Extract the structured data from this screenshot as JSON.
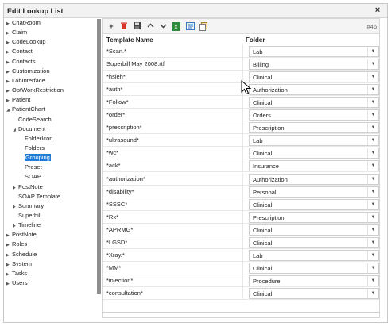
{
  "window": {
    "title": "Edit Lookup List",
    "close_glyph": "×"
  },
  "tree": {
    "items": [
      {
        "label": "ChatRoom",
        "level": 0,
        "arrow": true
      },
      {
        "label": "Claim",
        "level": 0,
        "arrow": true
      },
      {
        "label": "CodeLookup",
        "level": 0,
        "arrow": true
      },
      {
        "label": "Contact",
        "level": 0,
        "arrow": true
      },
      {
        "label": "Contacts",
        "level": 0,
        "arrow": true
      },
      {
        "label": "Customization",
        "level": 0,
        "arrow": true
      },
      {
        "label": "LabInterface",
        "level": 0,
        "arrow": true
      },
      {
        "label": "OptWorkRestriction",
        "level": 0,
        "arrow": true
      },
      {
        "label": "Patient",
        "level": 0,
        "arrow": true
      },
      {
        "label": "PatientChart",
        "level": 0,
        "arrow": true,
        "open": true
      },
      {
        "label": "CodeSearch",
        "level": 1,
        "arrow": false
      },
      {
        "label": "Document",
        "level": 1,
        "arrow": true,
        "open": true
      },
      {
        "label": "FolderIcon",
        "level": 2,
        "arrow": false
      },
      {
        "label": "Folders",
        "level": 2,
        "arrow": false
      },
      {
        "label": "Grouping",
        "level": 2,
        "arrow": false,
        "selected": true
      },
      {
        "label": "Preset",
        "level": 2,
        "arrow": false
      },
      {
        "label": "SOAP",
        "level": 2,
        "arrow": false
      },
      {
        "label": "PostNote",
        "level": 1,
        "arrow": true
      },
      {
        "label": "SOAP Template",
        "level": 1,
        "arrow": false
      },
      {
        "label": "Summary",
        "level": 1,
        "arrow": true
      },
      {
        "label": "Superbill",
        "level": 1,
        "arrow": false
      },
      {
        "label": "Timeline",
        "level": 1,
        "arrow": true
      },
      {
        "label": "PostNote",
        "level": 0,
        "arrow": true
      },
      {
        "label": "Roles",
        "level": 0,
        "arrow": true
      },
      {
        "label": "Schedule",
        "level": 0,
        "arrow": true
      },
      {
        "label": "System",
        "level": 0,
        "arrow": true
      },
      {
        "label": "Tasks",
        "level": 0,
        "arrow": true
      },
      {
        "label": "Users",
        "level": 0,
        "arrow": true
      }
    ]
  },
  "toolbar": {
    "icons": [
      "add-icon",
      "delete-icon",
      "save-icon",
      "move-up-icon",
      "move-down-icon",
      "excel-export-icon",
      "import-icon",
      "copy-icon"
    ],
    "count": "#46"
  },
  "table": {
    "col_name": "Template Name",
    "col_folder": "Folder",
    "rows": [
      {
        "name": "*Scan.*",
        "folder": "Lab"
      },
      {
        "name": "Superbill May 2008.rtf",
        "folder": "Billing"
      },
      {
        "name": "*hsieh*",
        "folder": "Clinical"
      },
      {
        "name": "*auth*",
        "folder": "Authorization"
      },
      {
        "name": "*Follow*",
        "folder": "Clinical"
      },
      {
        "name": "*order*",
        "folder": "Orders"
      },
      {
        "name": "*prescription*",
        "folder": "Prescription"
      },
      {
        "name": "*ultrasound*",
        "folder": "Lab"
      },
      {
        "name": "*wc*",
        "folder": "Clinical"
      },
      {
        "name": "*ack*",
        "folder": "Insurance"
      },
      {
        "name": "*authorization*",
        "folder": "Authorization"
      },
      {
        "name": "*disability*",
        "folder": "Personal"
      },
      {
        "name": "*SSSC*",
        "folder": "Clinical"
      },
      {
        "name": "*Rx*",
        "folder": "Prescription"
      },
      {
        "name": "*APRMG*",
        "folder": "Clinical"
      },
      {
        "name": "*LGSD*",
        "folder": "Clinical"
      },
      {
        "name": "*Xray.*",
        "folder": "Lab"
      },
      {
        "name": "*MM*",
        "folder": "Clinical"
      },
      {
        "name": "*injection*",
        "folder": "Procedure"
      },
      {
        "name": "*consultation*",
        "folder": "Clinical"
      }
    ]
  },
  "colors": {
    "selected_bg": "#1f7bd6",
    "scroll_thumb": "#8f8f8f"
  }
}
